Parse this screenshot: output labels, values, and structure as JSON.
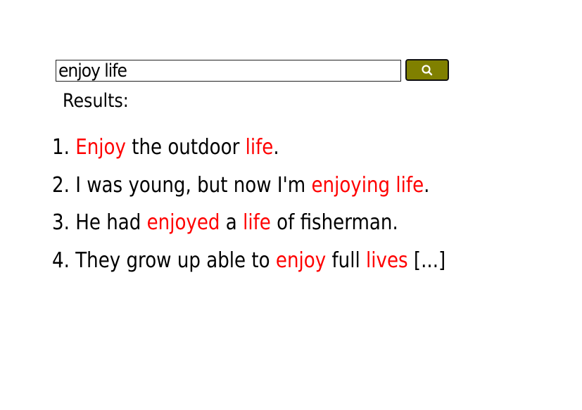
{
  "search": {
    "value": "enjoy life",
    "button_icon": "search-icon"
  },
  "results_label": "Results:",
  "colors": {
    "highlight": "#ff0000",
    "button": "#808000"
  },
  "results": [
    {
      "num": "1.",
      "parts": [
        {
          "t": "Enjoy",
          "h": true
        },
        {
          "t": " the outdoor ",
          "h": false
        },
        {
          "t": "life",
          "h": true
        },
        {
          "t": ".",
          "h": false
        }
      ]
    },
    {
      "num": "2.",
      "parts": [
        {
          "t": "I was young, but now I'm ",
          "h": false
        },
        {
          "t": "enjoying life",
          "h": true
        },
        {
          "t": ".",
          "h": false
        }
      ]
    },
    {
      "num": "3.",
      "parts": [
        {
          "t": "He had ",
          "h": false
        },
        {
          "t": "enjoyed",
          "h": true
        },
        {
          "t": " a ",
          "h": false
        },
        {
          "t": "life",
          "h": true
        },
        {
          "t": " of fisherman.",
          "h": false
        }
      ]
    },
    {
      "num": "4.",
      "parts": [
        {
          "t": "They grow up able to ",
          "h": false
        },
        {
          "t": "enjoy",
          "h": true
        },
        {
          "t": " full ",
          "h": false
        },
        {
          "t": "lives",
          "h": true
        },
        {
          "t": " [...]",
          "h": false
        }
      ]
    }
  ]
}
